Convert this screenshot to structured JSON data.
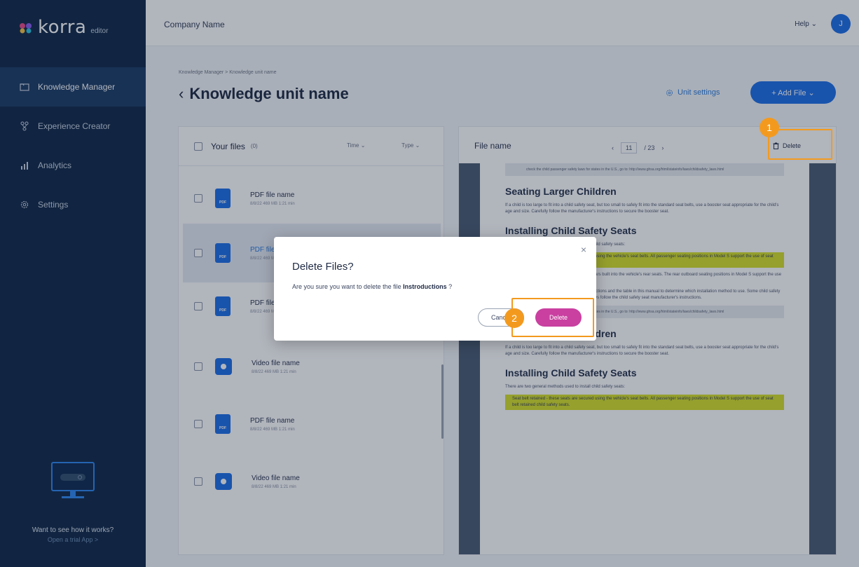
{
  "brand": {
    "logo_text": "korra",
    "logo_sub": "editor"
  },
  "sidebar": {
    "items": [
      {
        "label": "Knowledge Manager",
        "icon": "folder-icon",
        "active": true
      },
      {
        "label": "Experience Creator",
        "icon": "nodes-icon",
        "active": false
      },
      {
        "label": "Analytics",
        "icon": "bar-chart-icon",
        "active": false
      },
      {
        "label": "Settings",
        "icon": "gear-icon",
        "active": false
      }
    ],
    "promo": {
      "title": "Want to see how it works?",
      "link": "Open a trial App >"
    }
  },
  "topbar": {
    "company": "Company Name",
    "help": "Help ⌄",
    "avatar_initial": "J"
  },
  "page": {
    "breadcrumb": "Knowledge Manager  >  Knowledge unit name",
    "title": "Knowledge unit name",
    "unit_settings": "Unit settings",
    "add_file": "+ Add File ⌄"
  },
  "files": {
    "title": "Your files",
    "count": "(0)",
    "sort_time": "Time ⌄",
    "sort_type": "Type ⌄",
    "rows": [
      {
        "name": "PDF file name",
        "meta": "8/8/22   469 MB   1:21 min",
        "kind": "pdf"
      },
      {
        "name": "PDF file name",
        "meta": "8/8/22   469 MB   1:21 min",
        "kind": "pdf"
      },
      {
        "name": "PDF file name",
        "meta": "8/8/22   469 MB   1:21 min",
        "kind": "pdf"
      },
      {
        "name": "Video file name",
        "meta": "8/8/22   469 MB   1:21 min",
        "kind": "video"
      },
      {
        "name": "PDF file name",
        "meta": "8/8/22   469 MB   1:21 min",
        "kind": "pdf"
      },
      {
        "name": "Video file name",
        "meta": "8/8/22   469 MB   1:21 min",
        "kind": "video"
      }
    ],
    "pdf_badge": "PDF"
  },
  "preview": {
    "file_name": "File name",
    "page_current": "11",
    "page_total": "/ 23",
    "delete_label": "Delete",
    "doc": {
      "note1": "check the child passenger safety laws for states in the U.S., go to: http://www.ghsa.org/html/stateinfo/laws/childsafety_laws.html",
      "h1": "Seating Larger Children",
      "p1": "If a child is too large to fit into a child safety seat, but too small to safely fit into the standard seat belts, use a booster seat appropriate for the child's age and size. Carefully follow the manufacturer's instructions to secure the booster seat.",
      "h2": "Installing Child Safety Seats",
      "p2": "There are two general methods used to install child safety seats:",
      "hl1": "Seat belt retained - these seats are secured using the vehicle's seat belts. All passenger seating positions in Model S support the use of seat belt retained child safety seats.",
      "p3": "LATCH retained - these seats attach to anchor bars built into the vehicle's rear seats. The rear outboard seating positions in Model S support the use of LATCH retained child safety seats.",
      "p4": "Check the child safety seat manufacturer's instructions and the table in this manual to determine which installation method to use. Some child safety seats can be installed using either method. Always follow the child safety seat manufacturer's instructions.",
      "note2": "check the child passenger safety laws for states in the U.S., go to: http://www.ghsa.org/html/stateinfo/laws/childsafety_laws.html",
      "h3": "Seating Larger Children",
      "p5": "If a child is too large to fit into a child safety seat, but too small to safely fit into the standard seat belts, use a booster seat appropriate for the child's age and size. Carefully follow the manufacturer's instructions to secure the booster seat.",
      "h4": "Installing Child Safety Seats",
      "p6": "There are two general methods used to install child safety seats:",
      "hl2": "Seat belt retained - these seats are secured using the vehicle's seat belts. All passenger seating positions in Model S support the use of seat belt retained child safety seats."
    }
  },
  "dialog": {
    "title": "Delete Files?",
    "message_prefix": "Are you sure you want to delete the file ",
    "file": "Instroductions",
    "message_suffix": " ?",
    "cancel": "Cancel",
    "confirm": "Delete",
    "close": "×"
  },
  "callouts": {
    "one": "1",
    "two": "2"
  },
  "colors": {
    "sidebar": "#11294a",
    "accent": "#1d6fe8",
    "danger_button": "#c940a0",
    "callout": "#f39a1e",
    "highlight": "#d6e02a"
  }
}
